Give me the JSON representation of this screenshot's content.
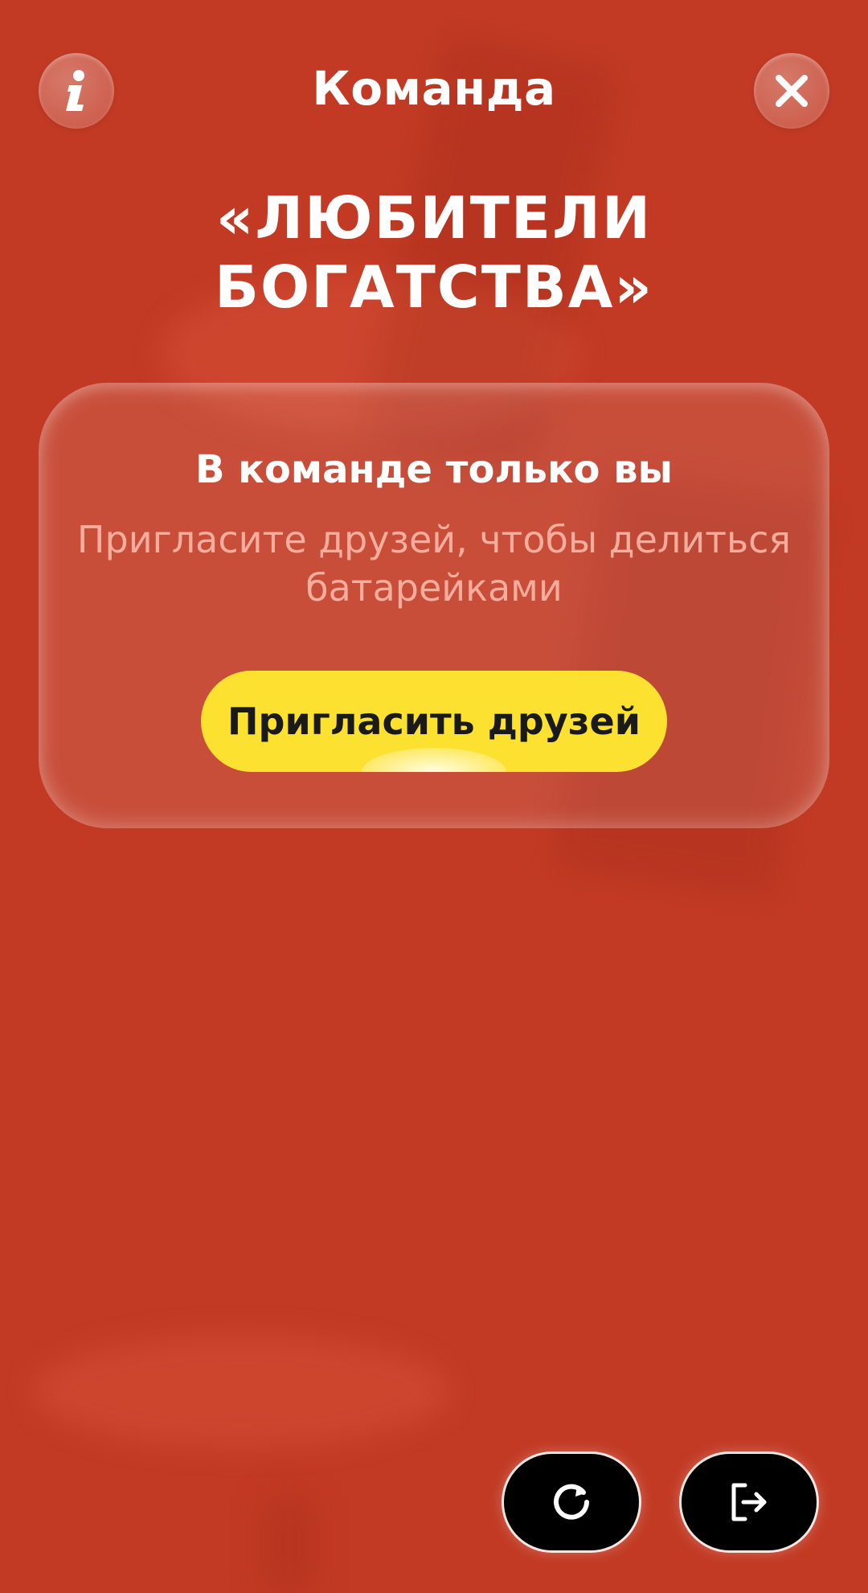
{
  "header": {
    "title": "Команда",
    "info_icon": "info-icon",
    "close_icon": "close-icon"
  },
  "team": {
    "name_line1": "«ЛЮБИТЕЛИ",
    "name_line2": "БОГАТСТВА»"
  },
  "card": {
    "title": "В команде только вы",
    "subtitle_line1": "Пригласите друзей, чтобы делиться",
    "subtitle_line2": "батарейками",
    "invite_label": "Пригласить друзей"
  },
  "bottom": {
    "refresh_icon": "refresh-icon",
    "exit_icon": "exit-icon"
  },
  "colors": {
    "background": "#c23a24",
    "accent_button": "#fde131",
    "dark_button": "#000000"
  }
}
